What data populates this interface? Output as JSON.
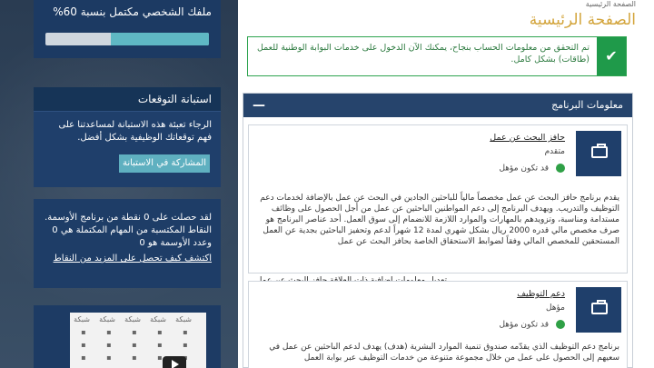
{
  "sidebar": {
    "profile": {
      "title": "ملفك الشخصي مكتمل بنسبة 60%",
      "progress": 0.6
    },
    "survey": {
      "title": "استبانة التوقعات",
      "text": "الرجاء تعبئة هذه الاستبانة لمساعدتنا على فهم توقعاتك الوظيفية بشكل أفضل.",
      "button": "المشاركة في الاستبانة"
    },
    "points": {
      "text1": "لقد حصلت على 0 نقطة من برنامج الأوسمة.",
      "text2": "النقاط المكتسبة من المهام المكتملة هي 0 وعدد الأوسمة هو 0",
      "link": "اكتشف كيف تحصل على المزيد من النقاط"
    },
    "video": {
      "tile_label": "شبكة"
    }
  },
  "main": {
    "breadcrumb": "الصفحة الرئيسية",
    "title": "الصفحة الرئيسية",
    "alert": "تم التحقق من معلومات الحساب بنجاح، يمكنك الآن الدخول على خدمات البوابة الوطنية للعمل (طاقات) بشكل كامل.",
    "section_title": "معلومات البرنامج",
    "programs": [
      {
        "name": "حافز البحث عن عمل",
        "level": "متقدم",
        "status": "قد تكون مؤهل",
        "description": "يقدم برنامج حافز البحث عن عمل مخصصاً مالياً للباحثين الجادين في البحث عن عمل بالإضافة لخدمات دعم التوظيف والتدريب. ويهدف البرنامج إلى دعم المواطنين الباحثين عن عمل من أجل الحصول على وظائف مستدامة ومناسبة، وتزويدهم بالمهارات والموارد اللازمة للانضمام إلى سوق العمل. أحد عناصر البرنامج هو صرف مخصص مالي قدره 2000 ريال بشكل شهري لمدة 12 شهراً لدعم وتحفيز الباحثين بجدية عن العمل المستحقين للمخصص المالي وفقاً لضوابط الاستحقاق الخاصة بحافز البحث عن عمل",
        "link": "تعديل معلومات إضافية ذات العلاقة حافز البحث عن عمل"
      },
      {
        "name": "دعم التوظيف",
        "level": "مؤهل",
        "status": "قد تكون مؤهل",
        "description": "برنامج دعم التوظيف الذي يقدّمه صندوق تنمية الموارد البشرية (هدف) يهدف لدعم الباحثين عن عمل في سعيهم إلى الحصول على عمل من خلال مجموعة متنوعة من خدمات التوظيف عبر بوابة العمل"
      }
    ]
  }
}
